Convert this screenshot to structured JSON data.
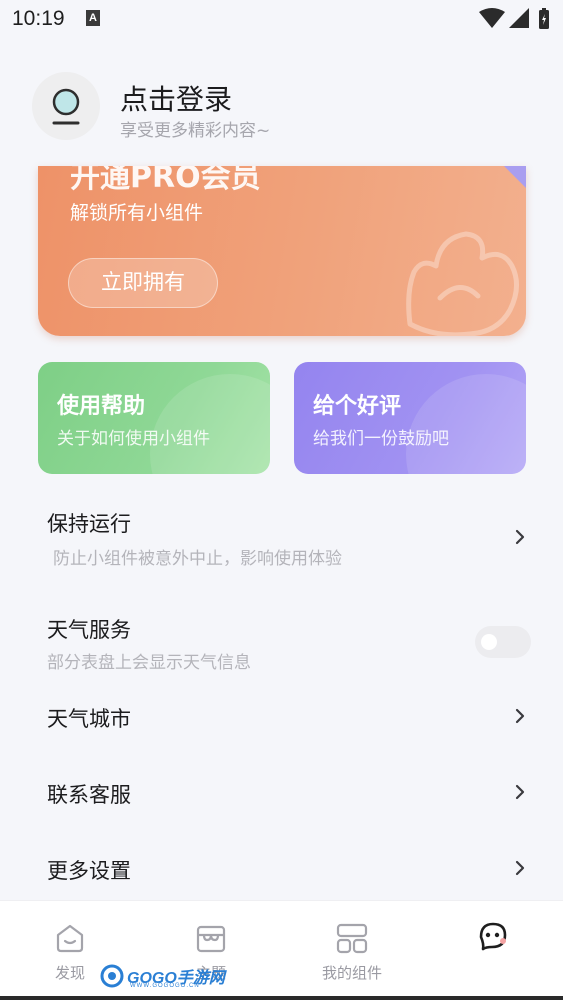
{
  "status_bar": {
    "time": "10:19",
    "notification_badge": "A",
    "icons": [
      "wifi-icon",
      "signal-icon",
      "battery-icon"
    ]
  },
  "profile": {
    "title": "点击登录",
    "subtitle": "享受更多精彩内容~"
  },
  "pro_banner": {
    "title": "开通PRO会员",
    "subtitle": "解锁所有小组件",
    "button_label": "立即拥有",
    "colors": {
      "from": "#ee9268",
      "to": "#f3b08e"
    }
  },
  "cards": {
    "help": {
      "title": "使用帮助",
      "subtitle": "关于如何使用小组件",
      "color": "#7ecf86"
    },
    "rate": {
      "title": "给个好评",
      "subtitle": "给我们一份鼓励吧",
      "color": "#9484ef"
    }
  },
  "settings": {
    "keep_running": {
      "title": "保持运行",
      "subtitle": "防止小组件被意外中止，影响使用体验"
    },
    "weather_service": {
      "title": "天气服务",
      "subtitle": "部分表盘上会显示天气信息",
      "enabled": false
    },
    "weather_city": {
      "title": "天气城市"
    },
    "contact_support": {
      "title": "联系客服"
    },
    "more_settings": {
      "title": "更多设置"
    }
  },
  "bottom_nav": {
    "discover": {
      "label": "发现",
      "icon": "discover-icon"
    },
    "store": {
      "label": "主题",
      "icon": "store-icon"
    },
    "my_widgets": {
      "label": "我的组件",
      "icon": "widgets-icon"
    },
    "profile": {
      "label": "",
      "icon": "profile-face-icon",
      "active": true
    }
  },
  "watermark": {
    "text": "GOGO手游网",
    "url_text": "WWW.GOGOGO.CN"
  }
}
